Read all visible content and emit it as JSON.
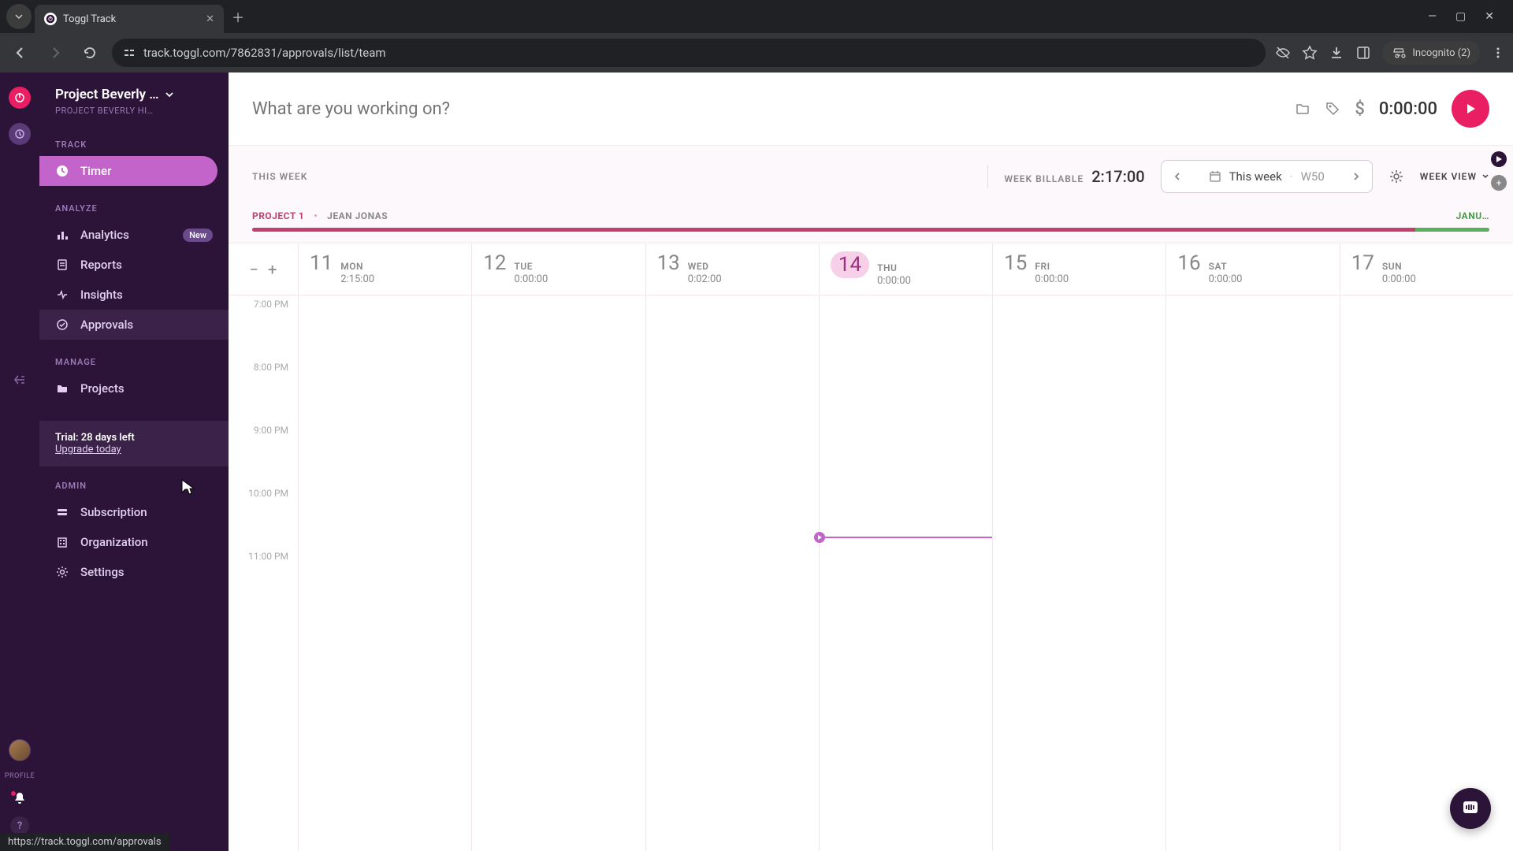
{
  "browser": {
    "tab_title": "Toggl Track",
    "url": "track.toggl.com/7862831/approvals/list/team",
    "incognito": "Incognito (2)",
    "status_url": "https://track.toggl.com/approvals"
  },
  "workspace": {
    "name": "Project Beverly …",
    "subtitle": "PROJECT BEVERLY HI…"
  },
  "nav": {
    "track_heading": "TRACK",
    "timer": "Timer",
    "analyze_heading": "ANALYZE",
    "analytics": "Analytics",
    "analytics_badge": "New",
    "reports": "Reports",
    "insights": "Insights",
    "approvals": "Approvals",
    "manage_heading": "MANAGE",
    "projects": "Projects",
    "admin_heading": "ADMIN",
    "subscription": "Subscription",
    "organization": "Organization",
    "settings": "Settings"
  },
  "trial": {
    "text": "Trial: 28 days left",
    "link": "Upgrade today"
  },
  "rail": {
    "profile": "PROFILE"
  },
  "timer": {
    "placeholder": "What are you working on?",
    "value": "0:00:00"
  },
  "toolbar": {
    "this_week": "THIS WEEK",
    "billable_label": "WEEK BILLABLE",
    "billable_value": "2:17:00",
    "range_label": "This week",
    "range_week": "W50",
    "view": "WEEK VIEW"
  },
  "projects": {
    "p1": "PROJECT 1",
    "p2": "JEAN JONAS",
    "p3": "JANU…"
  },
  "calendar": {
    "days": [
      {
        "num": "11",
        "name": "MON",
        "dur": "2:15:00",
        "today": false
      },
      {
        "num": "12",
        "name": "TUE",
        "dur": "0:00:00",
        "today": false
      },
      {
        "num": "13",
        "name": "WED",
        "dur": "0:02:00",
        "today": false
      },
      {
        "num": "14",
        "name": "THU",
        "dur": "0:00:00",
        "today": true
      },
      {
        "num": "15",
        "name": "FRI",
        "dur": "0:00:00",
        "today": false
      },
      {
        "num": "16",
        "name": "SAT",
        "dur": "0:00:00",
        "today": false
      },
      {
        "num": "17",
        "name": "SUN",
        "dur": "0:00:00",
        "today": false
      }
    ],
    "times": [
      "7:00 PM",
      "8:00 PM",
      "9:00 PM",
      "10:00 PM",
      "11:00 PM"
    ]
  }
}
